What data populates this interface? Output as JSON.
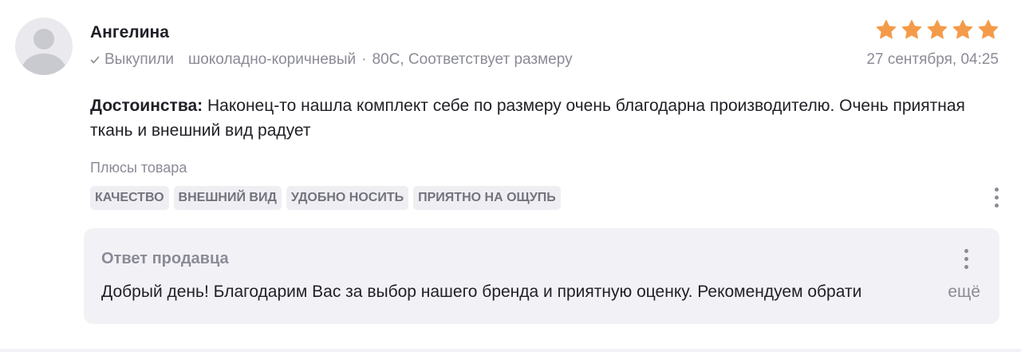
{
  "review": {
    "author": "Ангелина",
    "purchased_label": "Выкупили",
    "variant": "шоколадно-коричневый",
    "separator": "·",
    "size_info": "80C, Соответствует размеру",
    "date": "27 сентября, 04:25",
    "rating": 5,
    "rating_max": 5,
    "star_color": "#f49b4a",
    "advantages_label": "Достоинства:",
    "advantages_text": " Наконец-то нашла комплект себе по размеру очень благодарна производителю. Очень приятная ткань и внешний вид радует",
    "pros_title": "Плюсы товара",
    "tags": [
      "КАЧЕСТВО",
      "ВНЕШНИЙ ВИД",
      "УДОБНО НОСИТЬ",
      "ПРИЯТНО НА ОЩУПЬ"
    ],
    "more_icon": "more-vertical-icon"
  },
  "seller_reply": {
    "title": "Ответ продавца",
    "text": "Добрый день! Благодарим Вас за выбор нашего бренда и приятную оценку. Рекомендуем обрати",
    "more_link": "ещё",
    "more_icon": "more-vertical-icon"
  }
}
